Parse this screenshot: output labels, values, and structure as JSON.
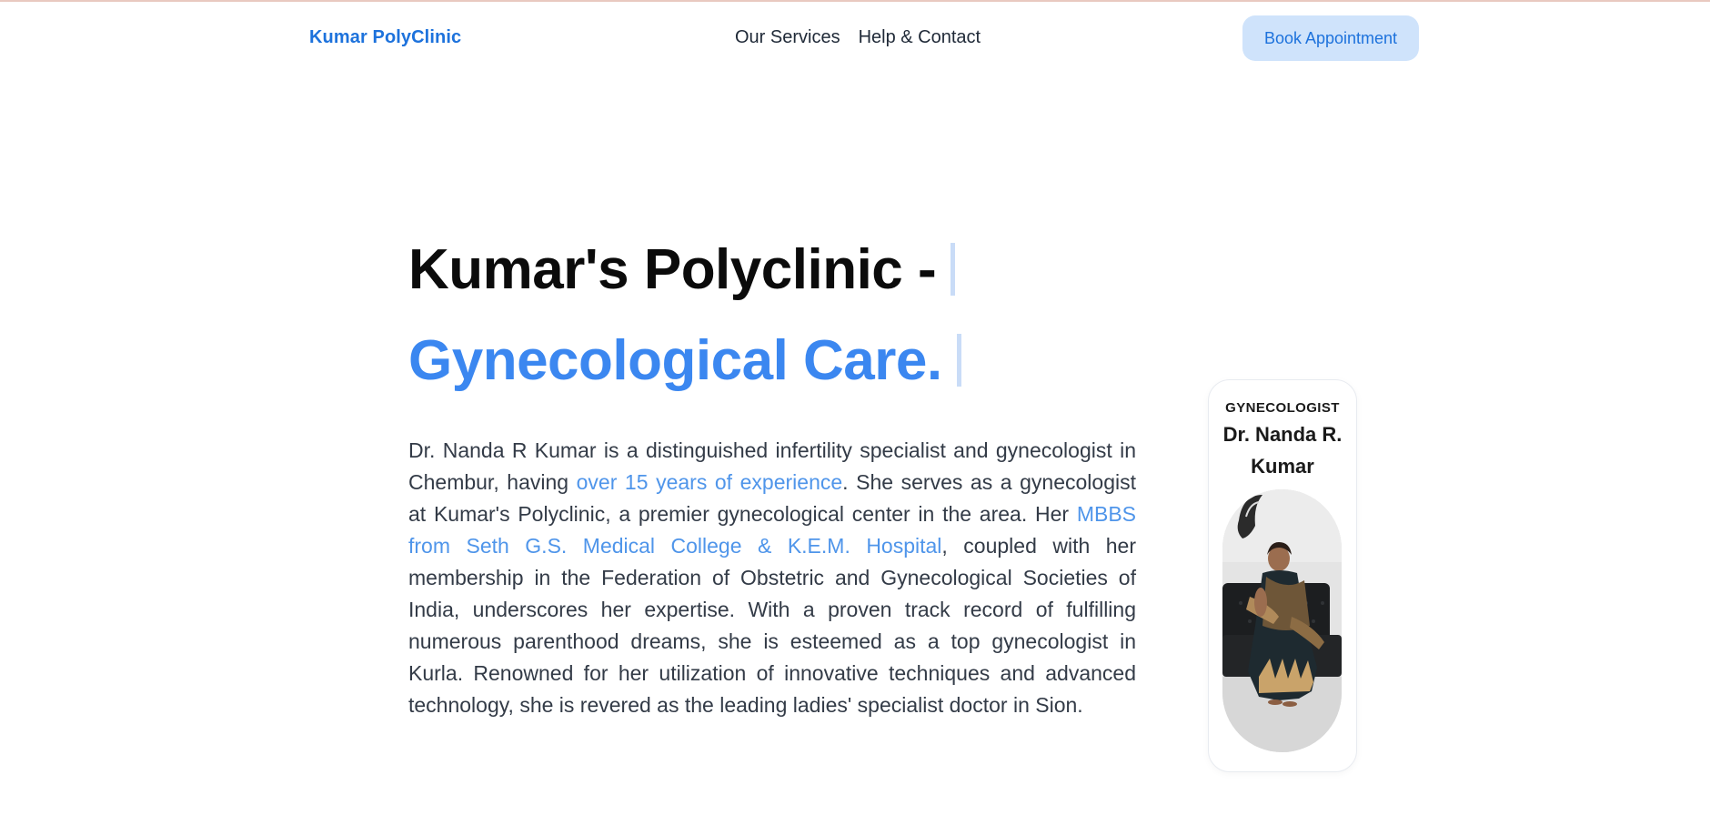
{
  "nav": {
    "brand": "Kumar PolyClinic",
    "links": [
      "Our Services",
      "Help & Contact"
    ],
    "cta": "Book Appointment"
  },
  "hero": {
    "title": "Kumar's Polyclinic -",
    "subtitle": "Gynecological Care.",
    "bio": {
      "p1": "Dr. Nanda R Kumar is a distinguished infertility specialist and gynecologist in Chembur, having ",
      "link1": "over 15 years of experience",
      "p2": ". She serves as a gynecologist at Kumar's Polyclinic, a premier gynecological center in the area. Her ",
      "link2": "MBBS from Seth G.S. Medical College & K.E.M. Hospital",
      "p3": ", coupled with her membership in the Federation of Obstetric and Gynecological Societies of India, underscores her expertise. With a proven track record of fulfilling numerous parenthood dreams, she is esteemed as a top gynecologist in Kurla. Renowned for her utilization of innovative techniques and advanced technology, she is revered as the leading ladies' specialist doctor in Sion."
    }
  },
  "doctor_card": {
    "role": "GYNECOLOGIST",
    "name": "Dr. Nanda R. Kumar"
  },
  "colors": {
    "brand": "#1d72dc",
    "accent": "#3b87f0",
    "highlight": "#4f95ea",
    "button_bg": "#cfe3fb"
  }
}
